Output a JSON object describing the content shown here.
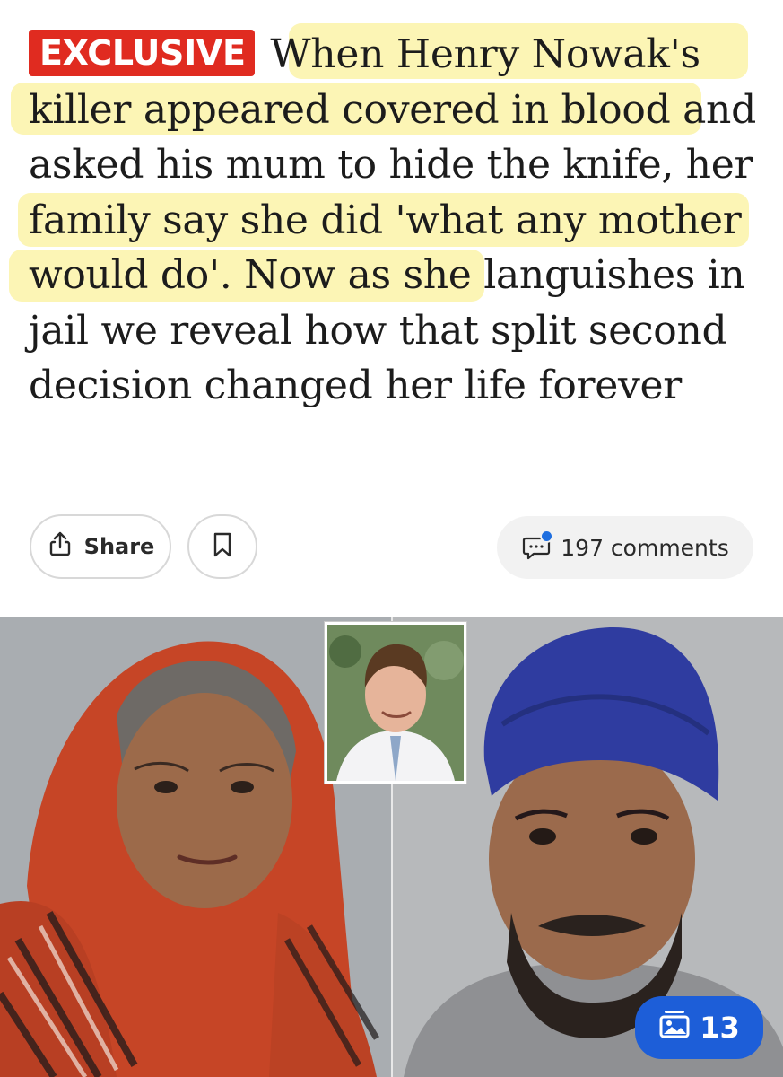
{
  "article": {
    "badge": "EXCLUSIVE",
    "headline": "When Henry Nowak's killer appeared covered in blood and asked his mum to hide the knife, her family say she did 'what any mother would do'. Now as she languishes in jail we reveal how that split second decision changed her life forever"
  },
  "actions": {
    "share_label": "Share",
    "share_icon": "share-icon",
    "bookmark_icon": "bookmark-icon",
    "comments_label": "197 comments",
    "comments_icon": "comment-icon"
  },
  "image": {
    "gallery_count": "13",
    "gallery_icon": "gallery-icon"
  },
  "colors": {
    "badge": "#e02b20",
    "highlight": "#fbf3a8",
    "gallery_button": "#1d5ed8",
    "notification_dot": "#1f6fe0"
  }
}
